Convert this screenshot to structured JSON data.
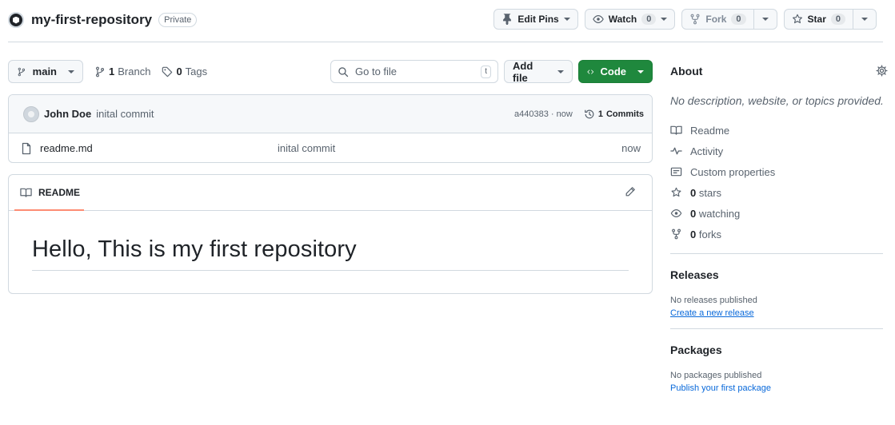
{
  "repo": {
    "name": "my-first-repository",
    "visibility": "Private",
    "avatar_icon": "org-logo-icon"
  },
  "header_actions": {
    "edit_pins": "Edit Pins",
    "watch": "Watch",
    "watch_count": "0",
    "fork": "Fork",
    "fork_count": "0",
    "star": "Star",
    "star_count": "0"
  },
  "toolbar": {
    "branch": "main",
    "branch_count": "1",
    "branch_label": "Branch",
    "tag_count": "0",
    "tag_label": "Tags",
    "search_placeholder": "Go to file",
    "search_shortcut": "t",
    "add_file": "Add file",
    "code": "Code",
    "code_color": "#1f883d"
  },
  "latest_commit": {
    "author": "John Doe",
    "message": "inital commit",
    "hash_time": "a440383 · now",
    "commits_count": "1",
    "commits_label": "Commits"
  },
  "files": [
    {
      "name": "readme.md",
      "commit": "inital commit",
      "age": "now",
      "icon": "file-icon"
    }
  ],
  "readme": {
    "tab": "README",
    "heading": "Hello, This is my first repository",
    "tab_underline_color": "#fd8c73"
  },
  "sidebar": {
    "about_title": "About",
    "description": "No description, website, or topics provided.",
    "items": {
      "readme": "Readme",
      "activity": "Activity",
      "custom_properties": "Custom properties",
      "stars_count": "0",
      "stars_label": "stars",
      "watching_count": "0",
      "watching_label": "watching",
      "forks_count": "0",
      "forks_label": "forks"
    },
    "releases": {
      "title": "Releases",
      "note": "No releases published",
      "link": "Create a new release"
    },
    "packages": {
      "title": "Packages",
      "note": "No packages published",
      "link": "Publish your first package"
    },
    "link_color": "#0969da"
  }
}
